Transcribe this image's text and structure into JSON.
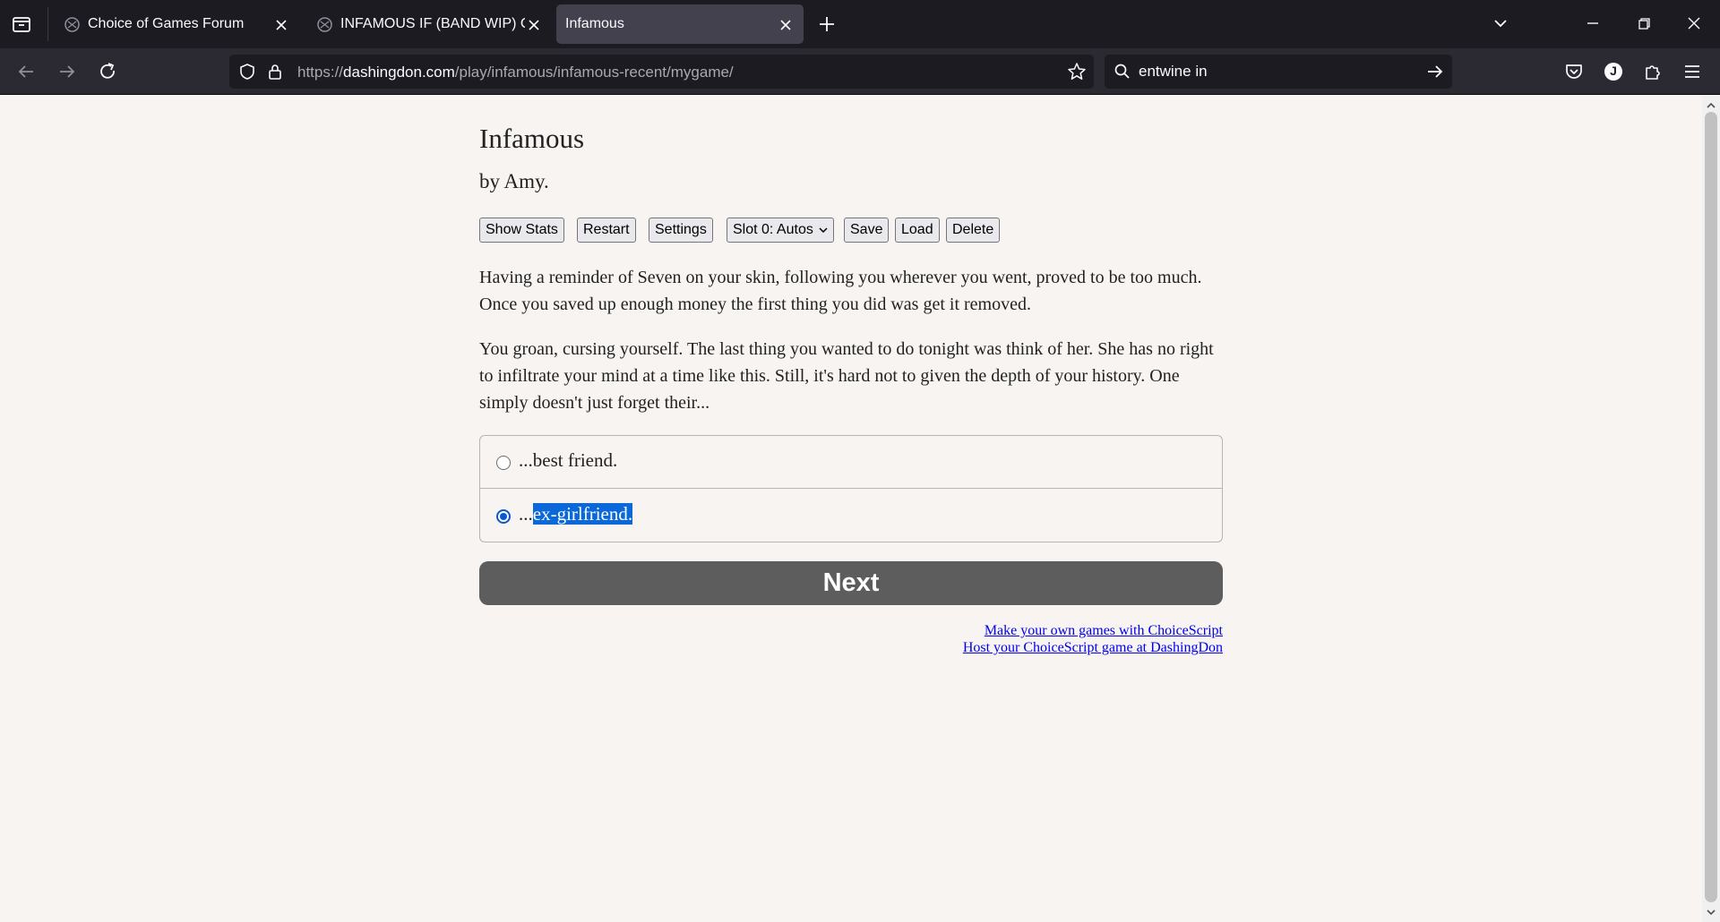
{
  "browser": {
    "tabs": [
      {
        "title": "Choice of Games Forum",
        "active": false
      },
      {
        "title": "INFAMOUS IF (BAND WIP) CHA",
        "active": false
      },
      {
        "title": "Infamous",
        "active": true
      }
    ],
    "url_prefix": "https://",
    "url_host": "dashingdon.com",
    "url_path": "/play/infamous/infamous-recent/mygame/",
    "search_value": "entwine in",
    "profile_initial": "J",
    "colors": {
      "chrome_dark": "#1c1b22",
      "toolbar": "#2b2a33",
      "active_tab": "#42414d"
    }
  },
  "game": {
    "title": "Infamous",
    "author": "by Amy.",
    "buttons": {
      "show_stats": "Show Stats",
      "restart": "Restart",
      "settings": "Settings",
      "slot": "Slot 0: Autos",
      "save": "Save",
      "load": "Load",
      "delete": "Delete"
    },
    "paragraphs": [
      "Having a reminder of Seven on your skin, following you wherever you went, proved to be too much. Once you saved up enough money the first thing you did was get it removed.",
      "You groan, cursing yourself. The last thing you wanted to do tonight was think of her. She has no right to infiltrate your mind at a time like this. Still, it's hard not to given the depth of your history. One simply doesn't just forget their..."
    ],
    "choices": [
      {
        "prefix": "...",
        "text": "best friend.",
        "selected": false
      },
      {
        "prefix": "...",
        "text": "ex-girlfriend.",
        "selected": true
      }
    ],
    "next_label": "Next",
    "links": {
      "make_games": "Make your own games with ChoiceScript",
      "host_game": "Host your ChoiceScript game at DashingDon"
    },
    "colors": {
      "background": "#f7f4f1",
      "next_button": "#5d5d5d",
      "link": "#0000ee",
      "selection": "#0a68d8"
    }
  }
}
